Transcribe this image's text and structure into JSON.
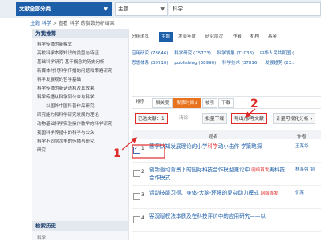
{
  "topbar": {
    "doc_class": "文献全部分类",
    "field": "主题",
    "query": "科学"
  },
  "breadcrumb": {
    "home": "主题 科学",
    "text": "查看 科学 的指数分析结果"
  },
  "sidebar": {
    "title": "为我推荐",
    "items": [
      "科学传播的新模式",
      "高校科学本原知识的类型与特征",
      "基础科学研究 基于概念的历史分析",
      "新媒体时代科学传播的问题和策略研究",
      "科学发展观的哲学基础",
      "科学传播的新话语和及其效果",
      "科学传播从科学到公众与科学",
      "——以国外中国科普作品研究",
      "研究能力和科学研究发展的理论",
      "动物基础科学实验操作教学的科学研究",
      "我国科学传播中的科学与公众",
      "科学不同层次里的传播与研究",
      "研究"
    ],
    "history_title": "检索历史",
    "history_sub": "科学"
  },
  "groups": {
    "label": "分组浏览",
    "items": [
      "主题",
      "发表年度",
      "研究层次",
      "作者",
      "机构",
      "基金"
    ],
    "active": "主题"
  },
  "facets": [
    [
      "应用研究 (78646)",
      "科学研究 (75773)",
      "科学发展 (71038)",
      "中华人民共和国 (..."
    ],
    [
      "思想体系 (38710)",
      "publishing (38990)",
      "科学技术 (37816)",
      "发展趋势 (23..."
    ]
  ],
  "sort": {
    "label": "排序",
    "items": [
      "相关度",
      "发表时间↓",
      "被引",
      "下载"
    ],
    "active": "发表时间↓"
  },
  "toolbar": {
    "selected": "已选文献：1",
    "clear": "清除",
    "batch_download": "批量下载",
    "export": "导出/参考文献",
    "viz": "计量可视化分析",
    "viz_arrow": "▾"
  },
  "table": {
    "header_title": "题名",
    "header_author": "作者"
  },
  "results": [
    {
      "num": "1",
      "title_pre": "基于认知发展理论的小学",
      "kw": "科学",
      "title_post": "动小击作",
      "tag_pre": "",
      "tail": "学策略探",
      "author": "王某华",
      "checked": true
    },
    {
      "num": "2",
      "title_pre": "创新驱动背景下的国际",
      "kw": "",
      "title_post": "科技合作模型兼论中",
      "tag_pre": "网络首发",
      "tail": "美科技合作模式",
      "author": "林某强 钢",
      "checked": false
    },
    {
      "num": "3",
      "title_pre": "运动技能习得、身体-大脑-环境的复杂动力模式",
      "kw": "",
      "title_post": "",
      "tag_pre": "网络首发",
      "tail": "",
      "author": "仇某",
      "checked": false
    },
    {
      "num": "4",
      "title_pre": "客观赋权法本质及在科技评价中的应用研究——以",
      "kw": "",
      "title_post": "",
      "tag_pre": "",
      "tail": "",
      "author": "",
      "checked": false
    }
  ],
  "annotations": {
    "one": "1",
    "two": "2"
  },
  "colors": {
    "accent": "#1d5ea8",
    "highlight": "#e02a2a",
    "sort_active": "#e8731c"
  }
}
